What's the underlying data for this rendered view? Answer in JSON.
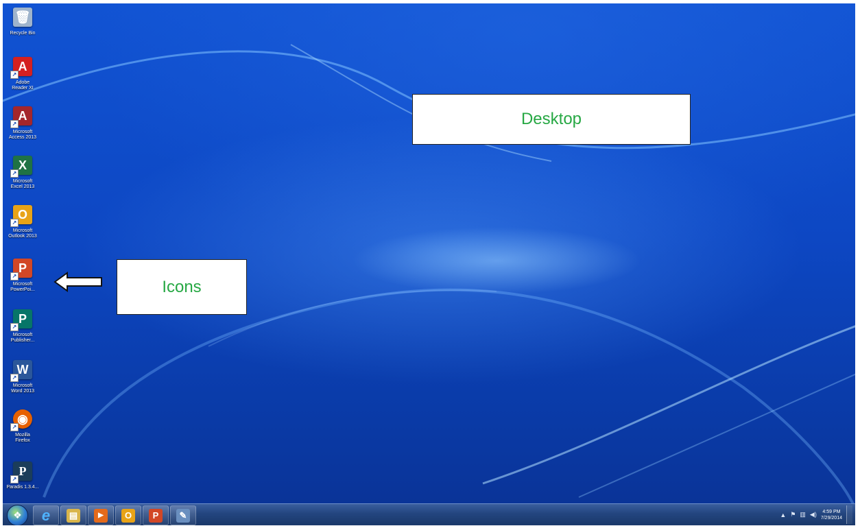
{
  "desktop": {
    "icons": [
      {
        "label": "Recycle Bin",
        "icon": "recycle-bin-icon",
        "glyph": "🗑",
        "color": "#9fb4cc"
      },
      {
        "label": "Adobe\nReader XI",
        "icon": "adobe-reader-icon",
        "glyph": "A",
        "color": "#d42020"
      },
      {
        "label": "Microsoft\nAccess 2013",
        "icon": "access-icon",
        "glyph": "A",
        "color": "#a4262c"
      },
      {
        "label": "Microsoft\nExcel 2013",
        "icon": "excel-icon",
        "glyph": "X",
        "color": "#1f7244"
      },
      {
        "label": "Microsoft\nOutlook 2013",
        "icon": "outlook-icon",
        "glyph": "O",
        "color": "#e8a317"
      },
      {
        "label": "Microsoft\nPowerPoi...",
        "icon": "powerpoint-icon",
        "glyph": "P",
        "color": "#d24726"
      },
      {
        "label": "Microsoft\nPublisher...",
        "icon": "publisher-icon",
        "glyph": "P",
        "color": "#077568"
      },
      {
        "label": "Microsoft\nWord 2013",
        "icon": "word-icon",
        "glyph": "W",
        "color": "#2b579a"
      },
      {
        "label": "Mozilla\nFirefox",
        "icon": "firefox-icon",
        "glyph": "◉",
        "color": "#e66000"
      },
      {
        "label": "Paradis 1.3.4...",
        "icon": "paradis-icon",
        "glyph": "P",
        "color": "#1b3d5a"
      }
    ]
  },
  "callouts": {
    "desktop": "Desktop",
    "icons": "Icons"
  },
  "taskbar": {
    "start_glyph": "❖",
    "pinned": [
      {
        "name": "internet-explorer-icon",
        "glyph": "e",
        "color": "#1e90ff"
      },
      {
        "name": "windows-explorer-icon",
        "glyph": "▤",
        "color": "#d9b54a"
      },
      {
        "name": "media-player-icon",
        "glyph": "▶",
        "color": "#e46a1b"
      },
      {
        "name": "outlook-taskbar-icon",
        "glyph": "O",
        "color": "#e8a317"
      },
      {
        "name": "powerpoint-taskbar-icon",
        "glyph": "P",
        "color": "#d24726"
      },
      {
        "name": "paint-icon",
        "glyph": "✎",
        "color": "#6a8fbf"
      }
    ],
    "tray": {
      "arrow": "▲",
      "flag": "⚑",
      "network": "▥",
      "volume": "◀)",
      "time": "4:59 PM",
      "date": "7/29/2014"
    }
  }
}
